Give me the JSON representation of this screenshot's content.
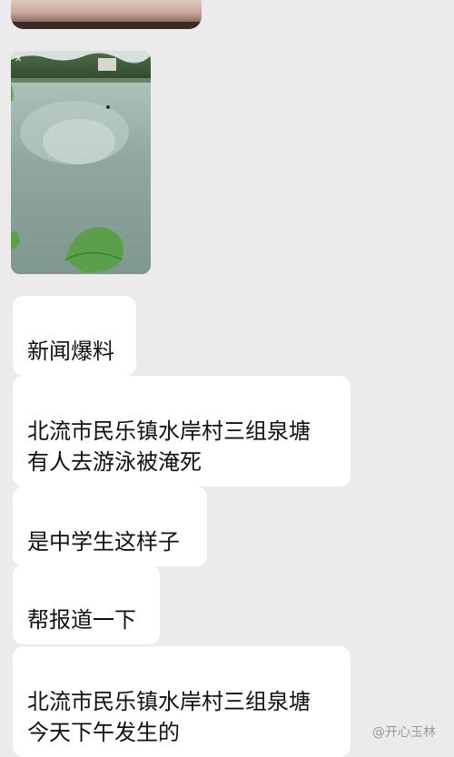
{
  "messages": [
    {
      "text": "新闻爆料"
    },
    {
      "text": "北流市民乐镇水岸村三组泉塘\n有人去游泳被淹死"
    },
    {
      "text": "是中学生这样子"
    },
    {
      "text": "帮报道一下"
    },
    {
      "text": "北流市民乐镇水岸村三组泉塘\n今天下午发生的"
    }
  ],
  "watermark": {
    "text": "@开心玉林"
  },
  "colors": {
    "background": "#ebebeb",
    "bubble": "#ffffff",
    "text": "#111111"
  },
  "icons": {
    "photo_close": "close-icon"
  }
}
